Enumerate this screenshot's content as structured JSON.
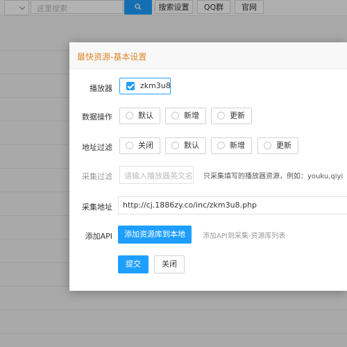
{
  "toolbar": {
    "search_placeholder": "这里搜索",
    "search_icon": "search-icon",
    "buttons": [
      "搜索设置",
      "QQ群",
      "官网"
    ]
  },
  "modal": {
    "title": "最快资源-基本设置",
    "player": {
      "label": "播放器",
      "option": "zkm3u8",
      "checked": true
    },
    "data_ops": {
      "label": "数据操作",
      "options": [
        "默认",
        "新增",
        "更新"
      ]
    },
    "addr_filter": {
      "label": "地址过滤",
      "options": [
        "关闭",
        "默认",
        "新增",
        "更新"
      ]
    },
    "collect_filter": {
      "label": "采集过滤",
      "placeholder": "请输入播放器英文名称",
      "hint": "只采集填写的播放器资源，例如：youku,qiyi"
    },
    "collect_url": {
      "label": "采集地址",
      "value": "http://cj.1886zy.co/inc/zkm3u8.php"
    },
    "add_api": {
      "label": "添加API",
      "button": "添加资源库到本地",
      "hint": "添加API到采集-资源库列表"
    },
    "submit": "提交",
    "close": "关闭"
  },
  "colors": {
    "accent": "#1e9fff",
    "title": "#e0882b"
  }
}
